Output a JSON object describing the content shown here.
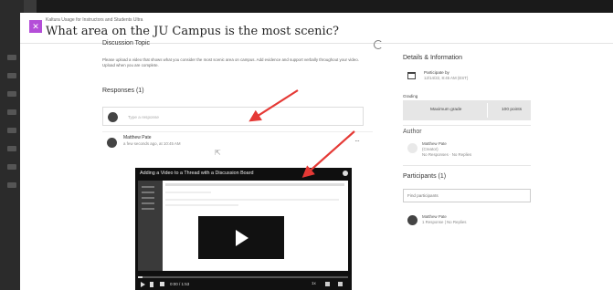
{
  "header": {
    "breadcrumb": "Kaltura Usage for Instructors and Students Ultra",
    "title": "What area on the JU Campus is the most scenic?"
  },
  "discussion": {
    "section_title": "Discussion Topic",
    "topic_text": "Please upload a video that shows what you consider the most scenic area on campus. Add evidence and support verbally throughout your video. Upload when you are complete.",
    "responses_title": "Responses (1)",
    "reply_placeholder": "Type a response"
  },
  "post": {
    "author": "Matthew Pate",
    "time": "a few seconds ago, at 10:45 AM",
    "more_label": "···"
  },
  "video": {
    "title": "Adding a Video to a Thread with a Discussion Board",
    "time": "0:00 / 1:53",
    "speed": "1x",
    "progress": 0.02
  },
  "details": {
    "title": "Details & Information",
    "participate_label": "Participate by",
    "participate_date": "12/14/22, 8:45 AM (EST)",
    "grading_label": "Grading",
    "max_grade_label": "Maximum grade",
    "points": "100 points"
  },
  "author": {
    "title": "Author",
    "name": "Matthew Pate",
    "role": "(Creator)",
    "stats": "No Responses · No Replies"
  },
  "participants": {
    "title": "Participants (1)",
    "find_placeholder": "Find participants",
    "items": [
      {
        "name": "Matthew Pate",
        "stats": "1 Response | No Replies"
      }
    ]
  },
  "colors": {
    "accent": "#b44ed8",
    "arrow": "#e53935"
  }
}
